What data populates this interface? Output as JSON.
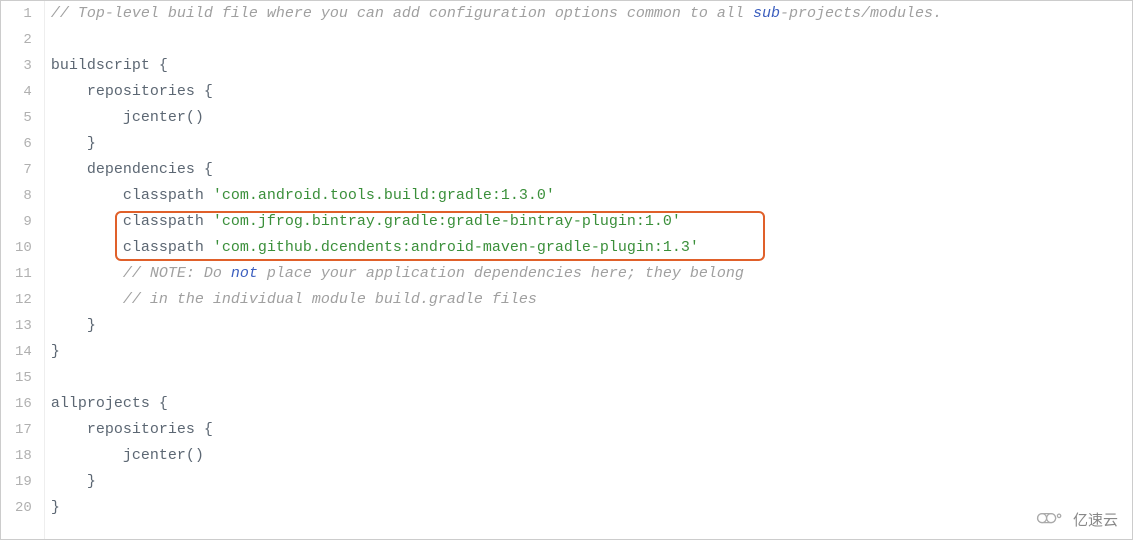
{
  "editor": {
    "lineNumbers": [
      "1",
      "2",
      "3",
      "4",
      "5",
      "6",
      "7",
      "8",
      "9",
      "10",
      "11",
      "12",
      "13",
      "14",
      "15",
      "16",
      "17",
      "18",
      "19",
      "20"
    ],
    "lines": {
      "l1": {
        "comment_prefix": "// Top-level build file where you can add configuration options common to all ",
        "sub": "sub",
        "comment_suffix": "-projects/modules."
      },
      "l2": "",
      "l3": "buildscript {",
      "l4": "    repositories {",
      "l5": "        jcenter()",
      "l6": "    }",
      "l7": "    dependencies {",
      "l8": {
        "prefix": "        classpath ",
        "str": "'com.android.tools.build:gradle:1.3.0'"
      },
      "l9": {
        "prefix": "        classpath ",
        "str": "'com.jfrog.bintray.gradle:gradle-bintray-plugin:1.0'"
      },
      "l10": {
        "prefix": "        classpath ",
        "str": "'com.github.dcendents:android-maven-gradle-plugin:1.3'"
      },
      "l11": {
        "pre": "        // NOTE: Do ",
        "not": "not",
        "post": " place your application dependencies here; they belong"
      },
      "l12": "        // in the individual module build.gradle files",
      "l13": "    }",
      "l14": "}",
      "l15": "",
      "l16": "allprojects {",
      "l17": "    repositories {",
      "l18": "        jcenter()",
      "l19": "    }",
      "l20": "}"
    }
  },
  "highlight": {
    "startLine": 9,
    "endLine": 10
  },
  "watermark": {
    "text": "亿速云"
  }
}
